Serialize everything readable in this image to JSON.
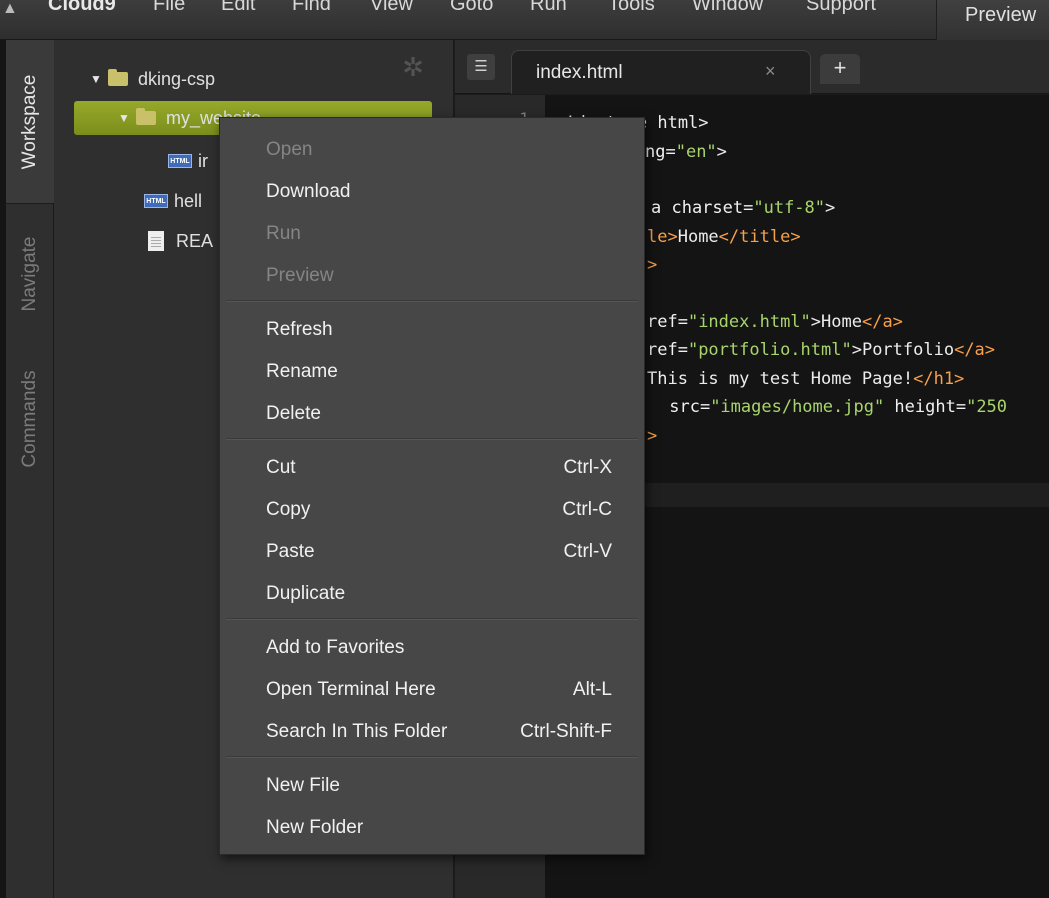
{
  "menubar": {
    "logo": "Cloud9",
    "items": [
      "File",
      "Edit",
      "Find",
      "View",
      "Goto",
      "Run",
      "Tools",
      "Window",
      "Support"
    ],
    "preview": "Preview"
  },
  "side_tabs": {
    "workspace": "Workspace",
    "navigate": "Navigate",
    "commands": "Commands"
  },
  "tree": {
    "root": "dking-csp",
    "folder": "my_website",
    "child_file": "ir",
    "file2": "hell",
    "file3": "REA"
  },
  "editor": {
    "tab_name": "index.html",
    "tab_close": "×",
    "add_tab": "+",
    "line_number": "1",
    "lines": [
      {
        "parts": [
          {
            "c": "txt",
            "t": "<!doctype html>"
          }
        ]
      },
      {
        "parts": [
          {
            "c": "attr",
            "t": "ng="
          },
          {
            "c": "str",
            "t": "\"en\""
          },
          {
            "c": "txt",
            "t": ">"
          }
        ]
      },
      {
        "parts": [
          {
            "c": "attr",
            "t": "a charset="
          },
          {
            "c": "str",
            "t": "\"utf-8\""
          },
          {
            "c": "txt",
            "t": ">"
          }
        ]
      },
      {
        "parts": [
          {
            "c": "tag",
            "t": "le>"
          },
          {
            "c": "txt",
            "t": "Home"
          },
          {
            "c": "tag",
            "t": "</title>"
          }
        ]
      },
      {
        "parts": [
          {
            "c": "tag",
            "t": ">"
          }
        ]
      },
      {
        "parts": [
          {
            "c": "attr",
            "t": "ref="
          },
          {
            "c": "str",
            "t": "\"index.html\""
          },
          {
            "c": "txt",
            "t": ">Home"
          },
          {
            "c": "tag",
            "t": "</a>"
          }
        ]
      },
      {
        "parts": [
          {
            "c": "attr",
            "t": "ref="
          },
          {
            "c": "str",
            "t": "\"portfolio.html\""
          },
          {
            "c": "txt",
            "t": ">Portfolio"
          },
          {
            "c": "tag",
            "t": "</a>"
          }
        ]
      },
      {
        "parts": [
          {
            "c": "txt",
            "t": "This is my test Home Page!"
          },
          {
            "c": "tag",
            "t": "</h1>"
          }
        ]
      },
      {
        "parts": [
          {
            "c": "attr",
            "t": " src="
          },
          {
            "c": "str",
            "t": "\"images/home.jpg\""
          },
          {
            "c": "attr",
            "t": " height="
          },
          {
            "c": "str",
            "t": "\"250"
          }
        ]
      },
      {
        "parts": [
          {
            "c": "tag",
            "t": ">"
          }
        ]
      }
    ]
  },
  "context_menu": {
    "open": "Open",
    "download": "Download",
    "run": "Run",
    "preview": "Preview",
    "refresh": "Refresh",
    "rename": "Rename",
    "delete": "Delete",
    "cut": "Cut",
    "cut_key": "Ctrl-X",
    "copy": "Copy",
    "copy_key": "Ctrl-C",
    "paste": "Paste",
    "paste_key": "Ctrl-V",
    "duplicate": "Duplicate",
    "add_favorites": "Add to Favorites",
    "open_terminal": "Open Terminal Here",
    "open_terminal_key": "Alt-L",
    "search_folder": "Search In This Folder",
    "search_folder_key": "Ctrl-Shift-F",
    "new_file": "New File",
    "new_folder": "New Folder"
  },
  "colors": {
    "selection": "#8a9d22",
    "string": "#a8d56b",
    "tag": "#f7a04b"
  }
}
